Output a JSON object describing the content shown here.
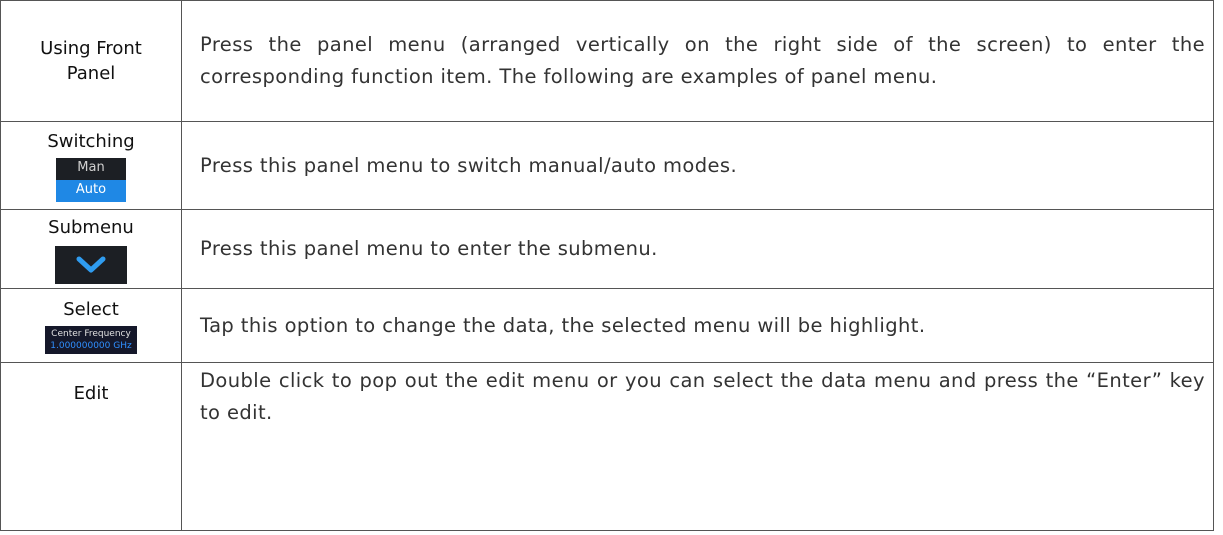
{
  "rows": [
    {
      "label": "Using Front Panel",
      "description": "Press the panel menu (arranged vertically on the right side of the screen) to enter the corresponding function item. The following are examples of panel menu."
    },
    {
      "label": "Switching",
      "widget": {
        "options": [
          "Man",
          "Auto"
        ],
        "selected": "Auto"
      },
      "description": "Press this panel menu to switch manual/auto modes."
    },
    {
      "label": "Submenu",
      "widget": {
        "icon": "chevron-down-icon"
      },
      "description": "Press this panel menu to enter the submenu."
    },
    {
      "label": "Select",
      "widget": {
        "title": "Center Frequency",
        "value": "1.000000000 GHz"
      },
      "description": "Tap this option to change the data, the selected menu will be highlight."
    },
    {
      "label": "Edit",
      "description": "Double click to pop out the edit menu or you can select the data menu and press the “Enter” key to edit."
    }
  ],
  "colors": {
    "widget_bg": "#1c1f24",
    "accent_blue": "#1f88e5",
    "value_blue": "#2f8fff"
  }
}
